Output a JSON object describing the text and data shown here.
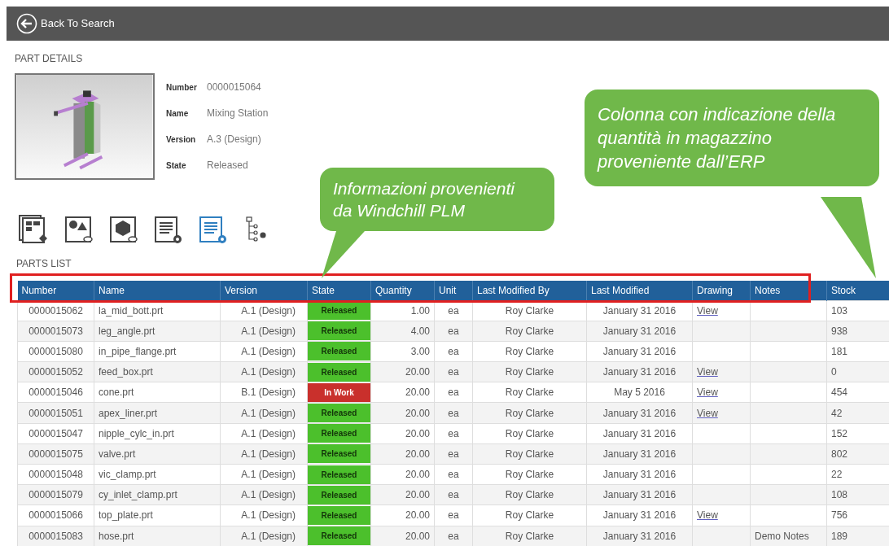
{
  "header": {
    "back_button": "Back To Search"
  },
  "part_details": {
    "title": "PART DETAILS",
    "fields": [
      {
        "label": "Number",
        "value": "0000015064"
      },
      {
        "label": "Name",
        "value": "Mixing Station"
      },
      {
        "label": "Version",
        "value": "A.3 (Design)"
      },
      {
        "label": "State",
        "value": "Released"
      }
    ]
  },
  "toolbar": [
    {
      "kind": "documents",
      "selected": false
    },
    {
      "kind": "shapes",
      "selected": false
    },
    {
      "kind": "cube",
      "selected": false
    },
    {
      "kind": "doc-gear",
      "selected": false
    },
    {
      "kind": "list-gear",
      "selected": true
    },
    {
      "kind": "tree",
      "selected": false
    }
  ],
  "parts_list": {
    "title": "PARTS LIST",
    "columns": [
      "Number",
      "Name",
      "Version",
      "State",
      "Quantity",
      "Unit",
      "Last Modified By",
      "Last Modified",
      "Drawing",
      "Notes",
      "Stock"
    ],
    "rows": [
      {
        "number": "0000015062",
        "name": "la_mid_bott.prt",
        "version": "A.1 (Design)",
        "state": {
          "label": "Released",
          "color": "#4cc02c"
        },
        "quantity": "1.00",
        "unit": "ea",
        "modified_by": "Roy Clarke",
        "modified": "January 31 2016",
        "drawing": "View",
        "stock": "103"
      },
      {
        "number": "0000015073",
        "name": "leg_angle.prt",
        "version": "A.1 (Design)",
        "state": {
          "label": "Released",
          "color": "#4cc02c"
        },
        "quantity": "4.00",
        "unit": "ea",
        "modified_by": "Roy Clarke",
        "modified": "January 31 2016",
        "stock": "938"
      },
      {
        "number": "0000015080",
        "name": "in_pipe_flange.prt",
        "version": "A.1 (Design)",
        "state": {
          "label": "Released",
          "color": "#4cc02c"
        },
        "quantity": "3.00",
        "unit": "ea",
        "modified_by": "Roy Clarke",
        "modified": "January 31 2016",
        "stock": "181"
      },
      {
        "number": "0000015052",
        "name": "feed_box.prt",
        "version": "A.1 (Design)",
        "state": {
          "label": "Released",
          "color": "#4cc02c"
        },
        "quantity": "20.00",
        "unit": "ea",
        "modified_by": "Roy Clarke",
        "modified": "January 31 2016",
        "drawing": "View",
        "stock": "0"
      },
      {
        "number": "0000015046",
        "name": "cone.prt",
        "version": "B.1 (Design)",
        "state": {
          "label": "In Work",
          "color": "#c9302c"
        },
        "quantity": "20.00",
        "unit": "ea",
        "modified_by": "Roy Clarke",
        "modified": "May 5 2016",
        "drawing": "View",
        "stock": "454"
      },
      {
        "number": "0000015051",
        "name": "apex_liner.prt",
        "version": "A.1 (Design)",
        "state": {
          "label": "Released",
          "color": "#4cc02c"
        },
        "quantity": "20.00",
        "unit": "ea",
        "modified_by": "Roy Clarke",
        "modified": "January 31 2016",
        "drawing": "View",
        "stock": "42"
      },
      {
        "number": "0000015047",
        "name": "nipple_cylc_in.prt",
        "version": "A.1 (Design)",
        "state": {
          "label": "Released",
          "color": "#4cc02c"
        },
        "quantity": "20.00",
        "unit": "ea",
        "modified_by": "Roy Clarke",
        "modified": "January 31 2016",
        "stock": "152"
      },
      {
        "number": "0000015075",
        "name": "valve.prt",
        "version": "A.1 (Design)",
        "state": {
          "label": "Released",
          "color": "#4cc02c"
        },
        "quantity": "20.00",
        "unit": "ea",
        "modified_by": "Roy Clarke",
        "modified": "January 31 2016",
        "stock": "802"
      },
      {
        "number": "0000015048",
        "name": "vic_clamp.prt",
        "version": "A.1 (Design)",
        "state": {
          "label": "Released",
          "color": "#4cc02c"
        },
        "quantity": "20.00",
        "unit": "ea",
        "modified_by": "Roy Clarke",
        "modified": "January 31 2016",
        "stock": "22"
      },
      {
        "number": "0000015079",
        "name": "cy_inlet_clamp.prt",
        "version": "A.1 (Design)",
        "state": {
          "label": "Released",
          "color": "#4cc02c"
        },
        "quantity": "20.00",
        "unit": "ea",
        "modified_by": "Roy Clarke",
        "modified": "January 31 2016",
        "stock": "108"
      },
      {
        "number": "0000015066",
        "name": "top_plate.prt",
        "version": "A.1 (Design)",
        "state": {
          "label": "Released",
          "color": "#4cc02c"
        },
        "quantity": "20.00",
        "unit": "ea",
        "modified_by": "Roy Clarke",
        "modified": "January 31 2016",
        "drawing": "View",
        "stock": "756"
      },
      {
        "number": "0000015083",
        "name": "hose.prt",
        "version": "A.1 (Design)",
        "state": {
          "label": "Released",
          "color": "#4cc02c"
        },
        "quantity": "20.00",
        "unit": "ea",
        "modified_by": "Roy Clarke",
        "modified": "January 31 2016",
        "notes": "Demo Notes",
        "stock": "189"
      }
    ]
  },
  "callouts": [
    {
      "text": "Informazioni provenienti da Windchill PLM"
    },
    {
      "text": "Colonna con indicazione della quantità in magazzino proveniente dall’ERP"
    }
  ]
}
